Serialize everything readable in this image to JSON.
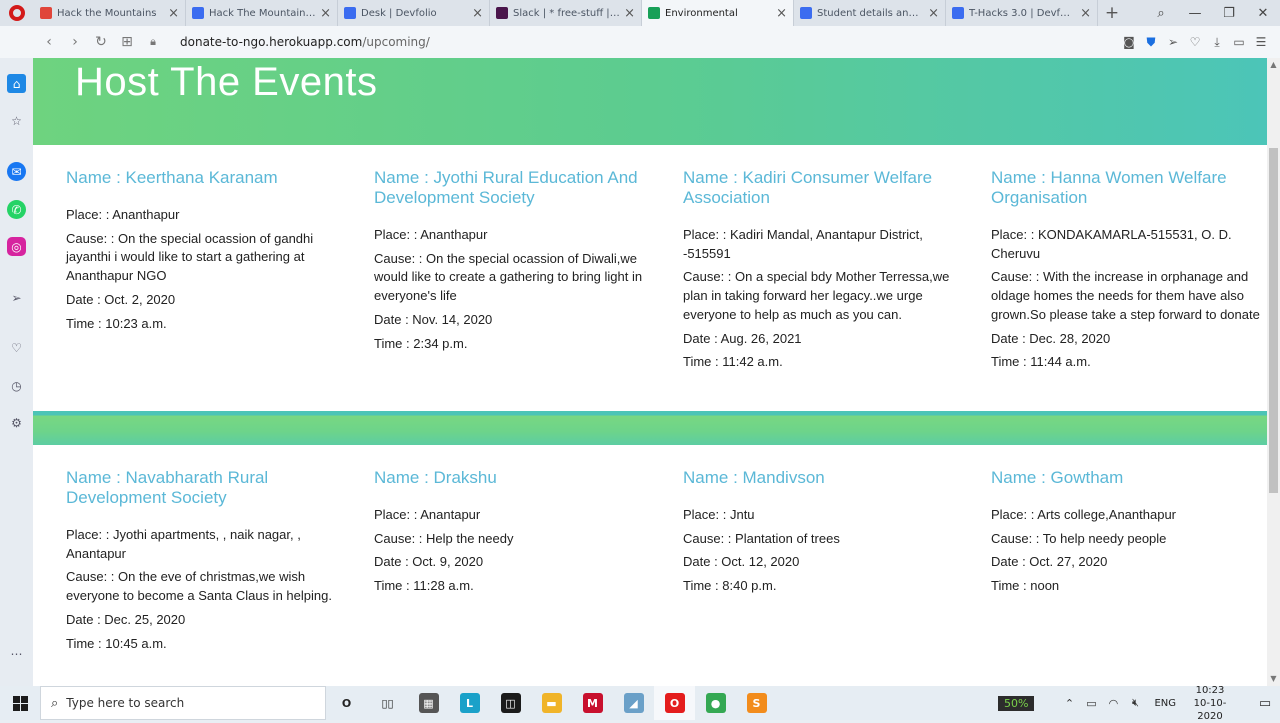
{
  "browser": {
    "tabs": [
      {
        "title": "Hack the Mountains",
        "color": "#e0453a"
      },
      {
        "title": "Hack The Mountains: Da",
        "color": "#3b6cf0"
      },
      {
        "title": "Desk | Devfolio",
        "color": "#3b6cf0"
      },
      {
        "title": "Slack | * free-stuff | Hack",
        "color": "#4a154b"
      },
      {
        "title": "Environmental",
        "color": "#18a058",
        "active": true
      },
      {
        "title": "Student details and doc",
        "color": "#3b6cf0"
      },
      {
        "title": "T-Hacks 3.0 | Devfolio",
        "color": "#3b6cf0"
      }
    ],
    "url_host": "donate-to-ngo.herokuapp.com",
    "url_path": "/upcoming/"
  },
  "page": {
    "title": "Host The Events",
    "colors": {
      "name": "#5bb8d7",
      "hero_start": "#6ed37f",
      "hero_end": "#4cc5b8"
    },
    "events": [
      {
        "name": "Name  : Keerthana Karanam",
        "place": "Place: : Ananthapur",
        "cause": "Cause: : On the special ocassion of gandhi jayanthi i would like to start a gathering at Ananthapur NGO",
        "date": "Date : Oct. 2, 2020",
        "time": "Time : 10:23 a.m."
      },
      {
        "name": "Name  : Jyothi Rural Education And Development Society",
        "place": "Place: : Ananthapur",
        "cause": "Cause: : On the special ocassion of Diwali,we would like to create a gathering to bring light in everyone's life",
        "date": "Date : Nov. 14, 2020",
        "time": "Time : 2:34 p.m."
      },
      {
        "name": "Name  : Kadiri Consumer Welfare Association",
        "place": "Place: : Kadiri Mandal, Anantapur District, -515591",
        "cause": "Cause: : On a special bdy Mother Terressa,we plan in taking forward her legacy..we urge everyone to help as much as you can.",
        "date": "Date : Aug. 26, 2021",
        "time": "Time : 11:42 a.m."
      },
      {
        "name": "Name  : Hanna Women Welfare Organisation",
        "place": "Place: :  KONDAKAMARLA-515531, O. D. Cheruvu",
        "cause": "Cause: : With the increase in orphanage and oldage homes the needs for them have also grown.So please take a step forward to donate",
        "date": "Date : Dec. 28, 2020",
        "time": "Time : 11:44 a.m."
      },
      {
        "name": "Name  : Navabharath Rural Development Society",
        "place": "Place: : Jyothi apartments, , naik nagar, , Anantapur",
        "cause": "Cause: : On the eve of christmas,we wish everyone to become a Santa Claus in helping.",
        "date": "Date : Dec. 25, 2020",
        "time": "Time : 10:45 a.m."
      },
      {
        "name": "Name  : Drakshu",
        "place": "Place: : Anantapur",
        "cause": "Cause: : Help the needy",
        "date": "Date : Oct. 9, 2020",
        "time": "Time : 11:28 a.m."
      },
      {
        "name": "Name  : Mandivson",
        "place": "Place: : Jntu",
        "cause": "Cause: : Plantation of trees",
        "date": "Date : Oct. 12, 2020",
        "time": "Time : 8:40 p.m."
      },
      {
        "name": "Name  : Gowtham",
        "place": "Place: : Arts college,Ananthapur",
        "cause": "Cause: : To help needy people",
        "date": "Date : Oct. 27, 2020",
        "time": "Time : noon"
      }
    ]
  },
  "taskbar": {
    "search_placeholder": "Type here to search",
    "battery": "50%",
    "language": "ENG",
    "time": "10:23",
    "date": "10-10-2020",
    "apps": [
      {
        "icon": "cortana-icon",
        "label": "O",
        "color": "#ffffff"
      },
      {
        "icon": "task-view-icon",
        "label": "▯▯",
        "color": "#ffffff"
      },
      {
        "icon": "calculator-icon",
        "label": "▦",
        "color": "#555555"
      },
      {
        "icon": "app-l-icon",
        "label": "L",
        "color": "#1aa1c9"
      },
      {
        "icon": "app-dark-icon",
        "label": "◫",
        "color": "#1b1b1b"
      },
      {
        "icon": "file-explorer-icon",
        "label": "▬",
        "color": "#f0b429"
      },
      {
        "icon": "mcafee-icon",
        "label": "M",
        "color": "#c8102e"
      },
      {
        "icon": "app-blue-icon",
        "label": "◢",
        "color": "#6aa0c8"
      },
      {
        "icon": "opera-icon",
        "label": "O",
        "color": "#e41d1d"
      },
      {
        "icon": "chrome-icon",
        "label": "●",
        "color": "#34a853"
      },
      {
        "icon": "sublime-icon",
        "label": "S",
        "color": "#f28c1c"
      }
    ]
  }
}
